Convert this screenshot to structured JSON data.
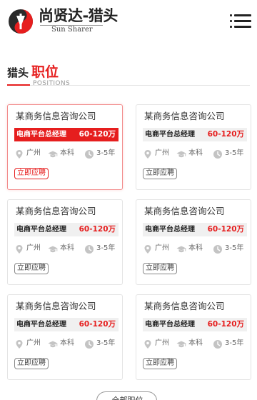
{
  "header": {
    "brand_cn": "尚贤达-猎头",
    "brand_en": "Sun Sharer",
    "menu_icon": "hamburger-menu-icon"
  },
  "section": {
    "title_prefix": "猎头",
    "title_main": "职位",
    "subtitle": "POSITIONS"
  },
  "jobs": [
    {
      "company": "某商务信息咨询公司",
      "title": "电商平台总经理",
      "salary": "60-120万",
      "city": "广州",
      "education": "本科",
      "experience": "3-5年",
      "apply": "立即应聘"
    },
    {
      "company": "某商务信息咨询公司",
      "title": "电商平台总经理",
      "salary": "60-120万",
      "city": "广州",
      "education": "本科",
      "experience": "3-5年",
      "apply": "立即应聘"
    },
    {
      "company": "某商务信息咨询公司",
      "title": "电商平台总经理",
      "salary": "60-120万",
      "city": "广州",
      "education": "本科",
      "experience": "3-5年",
      "apply": "立即应聘"
    },
    {
      "company": "某商务信息咨询公司",
      "title": "电商平台总经理",
      "salary": "60-120万",
      "city": "广州",
      "education": "本科",
      "experience": "3-5年",
      "apply": "立即应聘"
    },
    {
      "company": "某商务信息咨询公司",
      "title": "电商平台总经理",
      "salary": "60-120万",
      "city": "广州",
      "education": "本科",
      "experience": "3-5年",
      "apply": "立即应聘"
    },
    {
      "company": "某商务信息咨询公司",
      "title": "电商平台总经理",
      "salary": "60-120万",
      "city": "广州",
      "education": "本科",
      "experience": "3-5年",
      "apply": "立即应聘"
    }
  ],
  "more_button": "全部职位",
  "colors": {
    "accent": "#e61e1e",
    "icon_gray": "#c4c4c4"
  }
}
